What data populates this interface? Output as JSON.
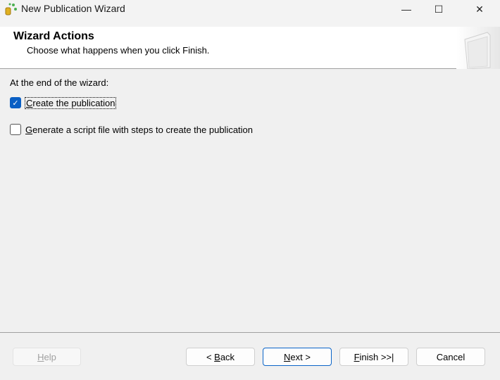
{
  "window": {
    "title": "New Publication Wizard",
    "minimize": "—",
    "maximize": "☐",
    "close": "✕"
  },
  "header": {
    "title": "Wizard Actions",
    "subtitle": "Choose what happens when you click Finish."
  },
  "main": {
    "label": "At the end of the wizard:",
    "options": [
      {
        "accel": "C",
        "rest": "reate the publication",
        "checked": true
      },
      {
        "accel": "G",
        "rest": "enerate a script file with steps to create the publication",
        "checked": false
      }
    ]
  },
  "buttons": {
    "help": {
      "pre": "",
      "accel": "H",
      "rest": "elp"
    },
    "back": {
      "pre": "< ",
      "accel": "B",
      "rest": "ack"
    },
    "next": {
      "pre": "",
      "accel": "N",
      "rest": "ext >"
    },
    "finish": {
      "pre": "",
      "accel": "F",
      "rest": "inish >>|"
    },
    "cancel": {
      "pre": "Cancel",
      "accel": "",
      "rest": ""
    }
  },
  "colors": {
    "accent": "#0a5fc4"
  }
}
